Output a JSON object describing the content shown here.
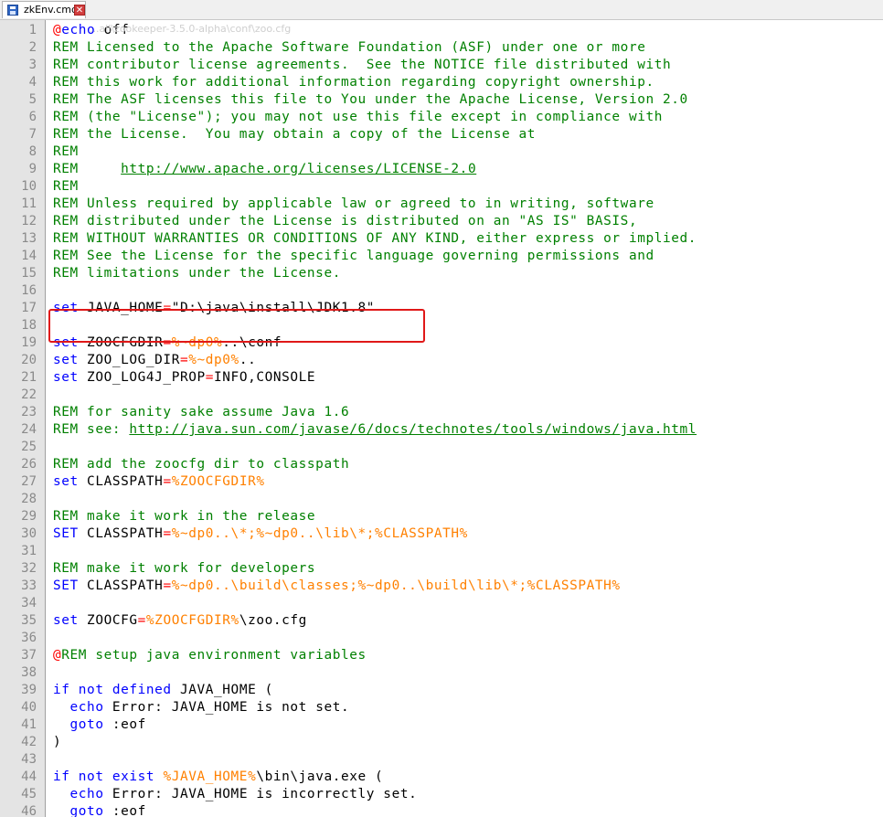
{
  "tab": {
    "label": "zkEnv.cmd",
    "close_glyph": "✕"
  },
  "tooltip_path": "...all\\zookeeper-3.5.0-alpha\\conf\\zoo.cfg",
  "colors": {
    "keyword": "#0000ff",
    "comment": "#008000",
    "operator": "#ff0000",
    "variable": "#ff8000",
    "highlight": "#e01818"
  },
  "lines": [
    {
      "n": "1",
      "tokens": [
        {
          "t": "@",
          "c": "t-op"
        },
        {
          "t": "echo",
          "c": "t-kw"
        },
        {
          "t": " off",
          "c": "t-pl"
        }
      ]
    },
    {
      "n": "2",
      "tokens": [
        {
          "t": "REM Licensed to the Apache Software Foundation (ASF) under one or more",
          "c": "t-cmt"
        }
      ]
    },
    {
      "n": "3",
      "tokens": [
        {
          "t": "REM contributor license agreements.  See the NOTICE file distributed with",
          "c": "t-cmt"
        }
      ]
    },
    {
      "n": "4",
      "tokens": [
        {
          "t": "REM this work for additional information regarding copyright ownership.",
          "c": "t-cmt"
        }
      ]
    },
    {
      "n": "5",
      "tokens": [
        {
          "t": "REM The ASF licenses this file to You under the Apache License, Version 2.0",
          "c": "t-cmt"
        }
      ]
    },
    {
      "n": "6",
      "tokens": [
        {
          "t": "REM (the \"License\"); you may not use this file except in compliance with",
          "c": "t-cmt"
        }
      ]
    },
    {
      "n": "7",
      "tokens": [
        {
          "t": "REM the License.  You may obtain a copy of the License at",
          "c": "t-cmt"
        }
      ]
    },
    {
      "n": "8",
      "tokens": [
        {
          "t": "REM",
          "c": "t-cmt"
        }
      ]
    },
    {
      "n": "9",
      "tokens": [
        {
          "t": "REM     ",
          "c": "t-cmt"
        },
        {
          "t": "http://www.apache.org/licenses/LICENSE-2.0",
          "c": "t-url"
        }
      ]
    },
    {
      "n": "10",
      "tokens": [
        {
          "t": "REM",
          "c": "t-cmt"
        }
      ]
    },
    {
      "n": "11",
      "tokens": [
        {
          "t": "REM Unless required by applicable law or agreed to in writing, software",
          "c": "t-cmt"
        }
      ]
    },
    {
      "n": "12",
      "tokens": [
        {
          "t": "REM distributed under the License is distributed on an \"AS IS\" BASIS,",
          "c": "t-cmt"
        }
      ]
    },
    {
      "n": "13",
      "tokens": [
        {
          "t": "REM WITHOUT WARRANTIES OR CONDITIONS OF ANY KIND, either express or implied.",
          "c": "t-cmt"
        }
      ]
    },
    {
      "n": "14",
      "tokens": [
        {
          "t": "REM See the License for the specific language governing permissions and",
          "c": "t-cmt"
        }
      ]
    },
    {
      "n": "15",
      "tokens": [
        {
          "t": "REM limitations under the License.",
          "c": "t-cmt"
        }
      ]
    },
    {
      "n": "16",
      "tokens": []
    },
    {
      "n": "17",
      "tokens": [
        {
          "t": "set",
          "c": "t-kw"
        },
        {
          "t": " JAVA_HOME",
          "c": "t-pl"
        },
        {
          "t": "=",
          "c": "t-op"
        },
        {
          "t": "\"D:\\java\\install\\JDK1.8\"",
          "c": "t-pl"
        }
      ]
    },
    {
      "n": "18",
      "tokens": []
    },
    {
      "n": "19",
      "tokens": [
        {
          "t": "set",
          "c": "t-kw"
        },
        {
          "t": " ZOOCFGDIR",
          "c": "t-pl"
        },
        {
          "t": "=",
          "c": "t-op"
        },
        {
          "t": "%~dp0%",
          "c": "t-var"
        },
        {
          "t": "..\\conf",
          "c": "t-pl"
        }
      ]
    },
    {
      "n": "20",
      "tokens": [
        {
          "t": "set",
          "c": "t-kw"
        },
        {
          "t": " ZOO_LOG_DIR",
          "c": "t-pl"
        },
        {
          "t": "=",
          "c": "t-op"
        },
        {
          "t": "%~dp0%",
          "c": "t-var"
        },
        {
          "t": "..",
          "c": "t-pl"
        }
      ]
    },
    {
      "n": "21",
      "tokens": [
        {
          "t": "set",
          "c": "t-kw"
        },
        {
          "t": " ZOO_LOG4J_PROP",
          "c": "t-pl"
        },
        {
          "t": "=",
          "c": "t-op"
        },
        {
          "t": "INFO,CONSOLE",
          "c": "t-pl"
        }
      ]
    },
    {
      "n": "22",
      "tokens": []
    },
    {
      "n": "23",
      "tokens": [
        {
          "t": "REM for sanity sake assume Java 1.6",
          "c": "t-cmt"
        }
      ]
    },
    {
      "n": "24",
      "tokens": [
        {
          "t": "REM see: ",
          "c": "t-cmt"
        },
        {
          "t": "http://java.sun.com/javase/6/docs/technotes/tools/windows/java.html",
          "c": "t-url"
        }
      ]
    },
    {
      "n": "25",
      "tokens": []
    },
    {
      "n": "26",
      "tokens": [
        {
          "t": "REM add the zoocfg dir to classpath",
          "c": "t-cmt"
        }
      ]
    },
    {
      "n": "27",
      "tokens": [
        {
          "t": "set",
          "c": "t-kw"
        },
        {
          "t": " CLASSPATH",
          "c": "t-pl"
        },
        {
          "t": "=",
          "c": "t-op"
        },
        {
          "t": "%ZOOCFGDIR%",
          "c": "t-var"
        }
      ]
    },
    {
      "n": "28",
      "tokens": []
    },
    {
      "n": "29",
      "tokens": [
        {
          "t": "REM make it work in the release",
          "c": "t-cmt"
        }
      ]
    },
    {
      "n": "30",
      "tokens": [
        {
          "t": "SET",
          "c": "t-kw"
        },
        {
          "t": " CLASSPATH",
          "c": "t-pl"
        },
        {
          "t": "=",
          "c": "t-op"
        },
        {
          "t": "%~dp0..\\*;%~dp0..\\lib\\*;%CLASSPATH%",
          "c": "t-var"
        }
      ]
    },
    {
      "n": "31",
      "tokens": []
    },
    {
      "n": "32",
      "tokens": [
        {
          "t": "REM make it work for developers",
          "c": "t-cmt"
        }
      ]
    },
    {
      "n": "33",
      "tokens": [
        {
          "t": "SET",
          "c": "t-kw"
        },
        {
          "t": " CLASSPATH",
          "c": "t-pl"
        },
        {
          "t": "=",
          "c": "t-op"
        },
        {
          "t": "%~dp0..\\build\\classes;%~dp0..\\build\\lib\\*;%CLASSPATH%",
          "c": "t-var"
        }
      ]
    },
    {
      "n": "34",
      "tokens": []
    },
    {
      "n": "35",
      "tokens": [
        {
          "t": "set",
          "c": "t-kw"
        },
        {
          "t": " ZOOCFG",
          "c": "t-pl"
        },
        {
          "t": "=",
          "c": "t-op"
        },
        {
          "t": "%ZOOCFGDIR%",
          "c": "t-var"
        },
        {
          "t": "\\zoo.cfg",
          "c": "t-pl"
        }
      ]
    },
    {
      "n": "36",
      "tokens": []
    },
    {
      "n": "37",
      "tokens": [
        {
          "t": "@",
          "c": "t-op"
        },
        {
          "t": "REM setup java environment variables",
          "c": "t-cmt"
        }
      ]
    },
    {
      "n": "38",
      "tokens": []
    },
    {
      "n": "39",
      "tokens": [
        {
          "t": "if not defined",
          "c": "t-kw"
        },
        {
          "t": " JAVA_HOME (",
          "c": "t-pl"
        }
      ]
    },
    {
      "n": "40",
      "tokens": [
        {
          "t": "  ",
          "c": "t-pl"
        },
        {
          "t": "echo",
          "c": "t-kw"
        },
        {
          "t": " Error: JAVA_HOME is not set.",
          "c": "t-pl"
        }
      ]
    },
    {
      "n": "41",
      "tokens": [
        {
          "t": "  ",
          "c": "t-pl"
        },
        {
          "t": "goto",
          "c": "t-kw"
        },
        {
          "t": " :eof",
          "c": "t-pl"
        }
      ]
    },
    {
      "n": "42",
      "tokens": [
        {
          "t": ")",
          "c": "t-pl"
        }
      ]
    },
    {
      "n": "43",
      "tokens": []
    },
    {
      "n": "44",
      "tokens": [
        {
          "t": "if not exist",
          "c": "t-kw"
        },
        {
          "t": " ",
          "c": "t-pl"
        },
        {
          "t": "%JAVA_HOME%",
          "c": "t-var"
        },
        {
          "t": "\\bin\\java.exe (",
          "c": "t-pl"
        }
      ]
    },
    {
      "n": "45",
      "tokens": [
        {
          "t": "  ",
          "c": "t-pl"
        },
        {
          "t": "echo",
          "c": "t-kw"
        },
        {
          "t": " Error: JAVA_HOME is incorrectly set.",
          "c": "t-pl"
        }
      ]
    },
    {
      "n": "46",
      "tokens": [
        {
          "t": "  ",
          "c": "t-pl"
        },
        {
          "t": "goto",
          "c": "t-kw"
        },
        {
          "t": " :eof",
          "c": "t-pl"
        }
      ]
    }
  ]
}
